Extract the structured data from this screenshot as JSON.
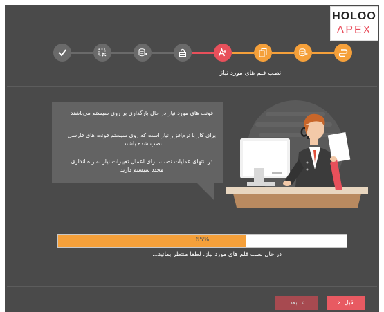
{
  "brand": {
    "line1": "HOLOO",
    "line2": "ΛPEX"
  },
  "steps": [
    {
      "icon": "check-icon",
      "state": "done"
    },
    {
      "icon": "select-icon",
      "state": "done"
    },
    {
      "icon": "database-icon",
      "state": "done"
    },
    {
      "icon": "lock-icon",
      "state": "done"
    },
    {
      "icon": "font-icon",
      "state": "current"
    },
    {
      "icon": "copy-icon",
      "state": "todo"
    },
    {
      "icon": "database-icon",
      "state": "todo"
    },
    {
      "icon": "link-icon",
      "state": "todo"
    }
  ],
  "current_step_label": "نصب قلم های مورد نیاز",
  "info": {
    "p1": "فونت های مورد نیاز در حال بارگذاری بر روی سیستم می‌باشند",
    "p2": "برای کار با نرم‌افزار نیاز است که روی سیستم فونت های فارسی نصب شده باشند.",
    "p3": "در انتهای عملیات نصب، برای اعمال تغییرات نیاز به راه اندازی مجدد سیستم دارید"
  },
  "progress": {
    "value": 0.65,
    "label": "65%"
  },
  "status_text": "در حال نصب قلم های مورد نیاز. لطفا منتظر بمانید...",
  "buttons": {
    "next": "بعد",
    "prev": "قبل"
  },
  "colors": {
    "background": "#4a4a4a",
    "accent_orange": "#f5a03a",
    "accent_red": "#e8505b",
    "done_gray": "#6a6a6a"
  }
}
